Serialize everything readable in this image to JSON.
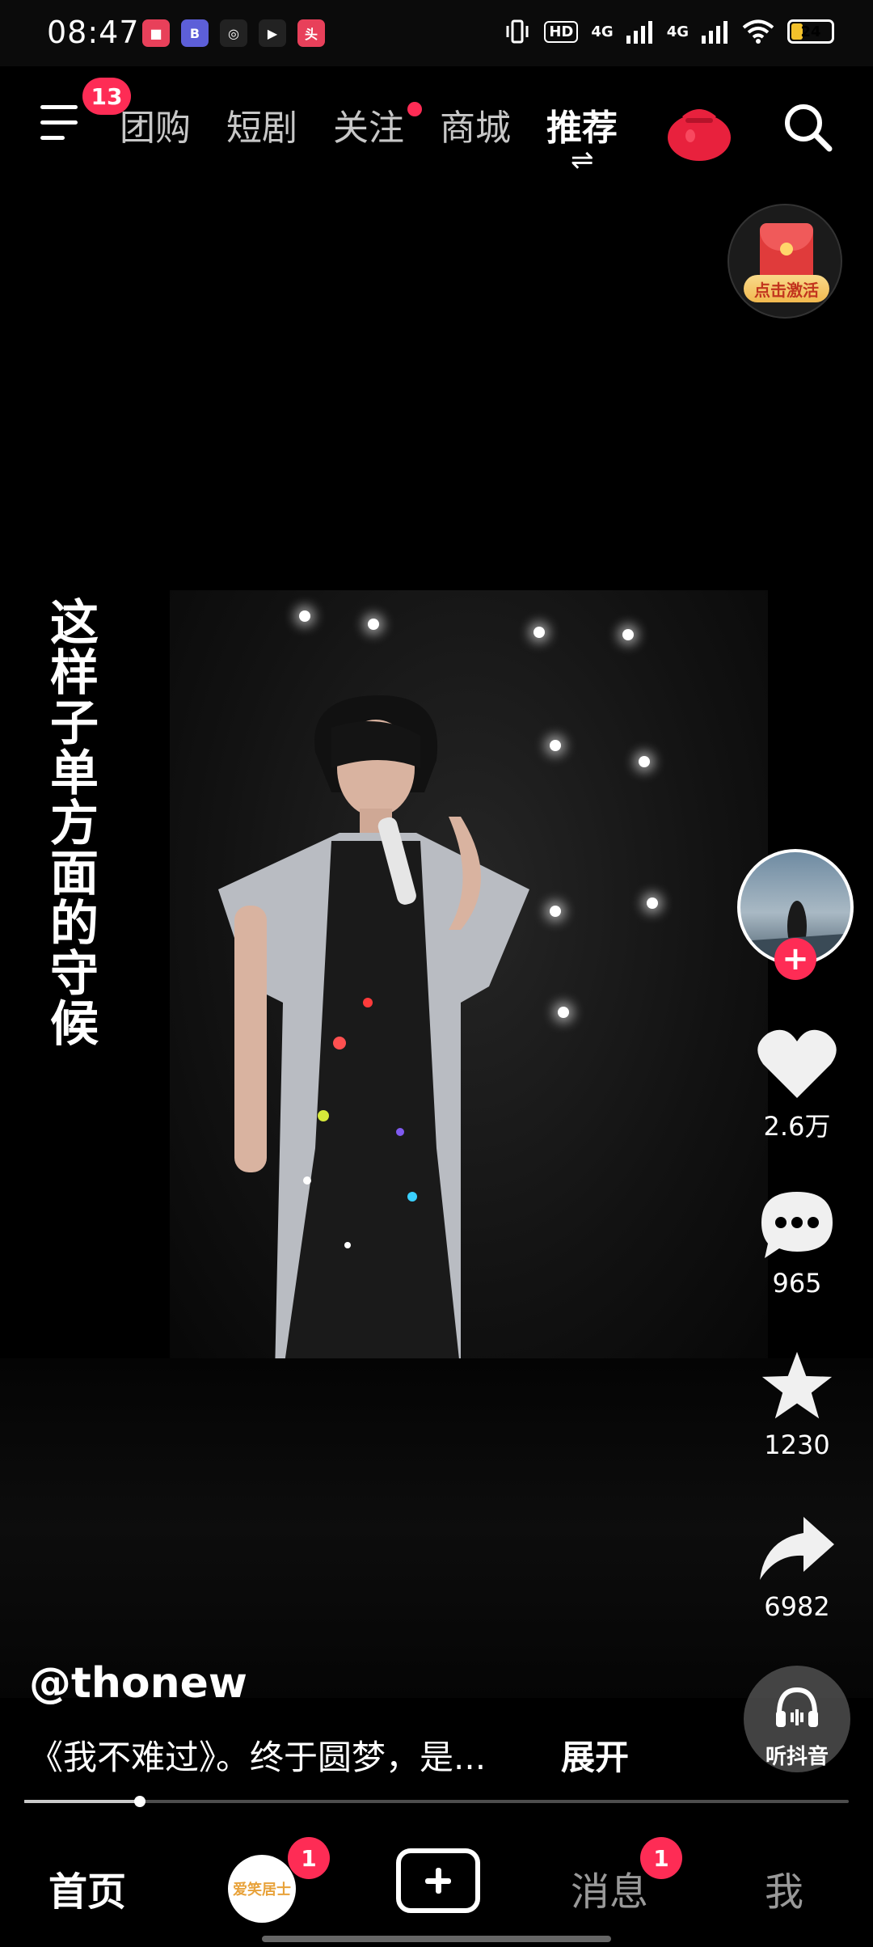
{
  "status_bar": {
    "time": "08:47",
    "notification_apps": [
      {
        "icon": "app-notification-icon-1",
        "color": "#e8405a",
        "glyph": "■"
      },
      {
        "icon": "app-notification-icon-2",
        "color": "#5d5fd8",
        "glyph": "B"
      },
      {
        "icon": "app-notification-icon-3",
        "color": "#222222",
        "glyph": "◎"
      },
      {
        "icon": "app-notification-icon-4",
        "color": "#222222",
        "glyph": "▶"
      },
      {
        "icon": "app-notification-icon-5",
        "color": "#e8405a",
        "glyph": "头"
      }
    ],
    "hd_label": "HD",
    "network_1": "4G",
    "network_2": "4G",
    "battery": "24"
  },
  "top_nav": {
    "menu_badge": "13",
    "tabs": [
      {
        "label": "团购",
        "active": false,
        "dot": false
      },
      {
        "label": "短剧",
        "active": false,
        "dot": false
      },
      {
        "label": "关注",
        "active": false,
        "dot": true
      },
      {
        "label": "商城",
        "active": false,
        "dot": false
      },
      {
        "label": "推荐",
        "active": true,
        "dot": false
      }
    ],
    "swap_glyph": "⇌"
  },
  "red_packet": {
    "label": "点击激活"
  },
  "video": {
    "lyric": "这样子单方面的守候"
  },
  "actions": {
    "likes": "2.6万",
    "comments": "965",
    "favorites": "1230",
    "shares": "6982",
    "listen_label": "听抖音"
  },
  "caption": {
    "author": "@thonew",
    "description": "《我不难过》。终于圆梦，是...",
    "more": "展开"
  },
  "progress": {
    "fraction": 0.14
  },
  "bottom_nav": {
    "home": "首页",
    "friends_avatar_text": "爱笑居士",
    "friends_badge": "1",
    "messages": "消息",
    "messages_badge": "1",
    "me": "我"
  },
  "colors": {
    "accent": "#fe2c55",
    "background": "#000000"
  }
}
